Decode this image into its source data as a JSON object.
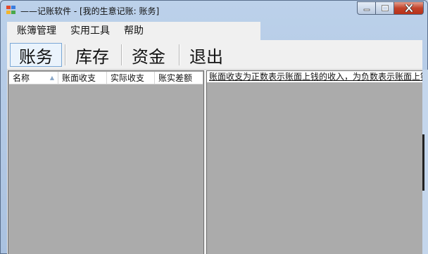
{
  "window": {
    "title": "——记账软件 - [我的生意记账: 账务]",
    "icons": {
      "app": "app-icon",
      "minimize": "minimize-icon",
      "maximize": "maximize-icon",
      "close": "close-icon"
    },
    "colors": {
      "workspace": "#ababab",
      "accent": "#7aa7d6",
      "close_button": "#c2432a"
    }
  },
  "menu": {
    "items": [
      {
        "label": "账簿管理"
      },
      {
        "label": "实用工具"
      },
      {
        "label": "帮助"
      }
    ]
  },
  "toolbar": {
    "buttons": [
      {
        "label": "账务",
        "pressed": true
      },
      {
        "label": "库存",
        "pressed": false
      },
      {
        "label": "资金",
        "pressed": false
      },
      {
        "label": "退出",
        "pressed": false
      }
    ]
  },
  "list": {
    "columns": [
      {
        "label": "名称",
        "sort_indicator": "sort-ascending-icon"
      },
      {
        "label": "账面收支"
      },
      {
        "label": "实际收支"
      },
      {
        "label": "账实差额"
      }
    ],
    "rows": []
  },
  "detail": {
    "hint": "账面收支为正数表示账面上钱的收入，为负数表示账面上钱"
  }
}
